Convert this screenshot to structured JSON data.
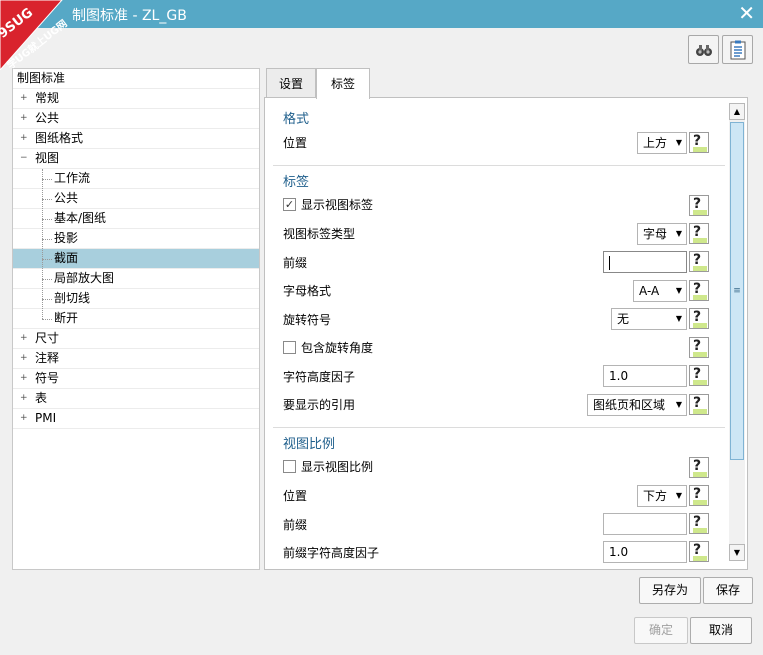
{
  "window": {
    "title": "制图标准 - ZL_GB",
    "close_glyph": "✕"
  },
  "watermark": {
    "line1": "9SUG",
    "line2": "学UG就上UG网"
  },
  "toolbar": [
    {
      "icon": "binoculars-icon"
    },
    {
      "icon": "clipboard-list-icon"
    }
  ],
  "tree": {
    "root": "制图标准",
    "items": [
      {
        "label": "常规",
        "level": 1,
        "expander": "+"
      },
      {
        "label": "公共",
        "level": 1,
        "expander": "+"
      },
      {
        "label": "图纸格式",
        "level": 1,
        "expander": "+"
      },
      {
        "label": "视图",
        "level": 1,
        "expander": "−"
      },
      {
        "label": "工作流",
        "level": 2
      },
      {
        "label": "公共",
        "level": 2
      },
      {
        "label": "基本/图纸",
        "level": 2
      },
      {
        "label": "投影",
        "level": 2
      },
      {
        "label": "截面",
        "level": 2,
        "selected": true
      },
      {
        "label": "局部放大图",
        "level": 2
      },
      {
        "label": "剖切线",
        "level": 2
      },
      {
        "label": "断开",
        "level": 2
      },
      {
        "label": "尺寸",
        "level": 1,
        "expander": "+"
      },
      {
        "label": "注释",
        "level": 1,
        "expander": "+"
      },
      {
        "label": "符号",
        "level": 1,
        "expander": "+"
      },
      {
        "label": "表",
        "level": 1,
        "expander": "+"
      },
      {
        "label": "PMI",
        "level": 1,
        "expander": "+"
      }
    ]
  },
  "tabs": [
    {
      "label": "设置",
      "active": false
    },
    {
      "label": "标签",
      "active": true
    }
  ],
  "sections": {
    "format": {
      "title": "格式",
      "position_label": "位置",
      "position_value": "上方"
    },
    "label": {
      "title": "标签",
      "show_view_label": "显示视图标签",
      "show_view_label_checked": true,
      "label_type_label": "视图标签类型",
      "label_type_value": "字母",
      "prefix_label": "前缀",
      "prefix_value": "",
      "letter_format_label": "字母格式",
      "letter_format_value": "A-A",
      "rotation_symbol_label": "旋转符号",
      "rotation_symbol_value": "无",
      "include_rotation_angle": "包含旋转角度",
      "include_rotation_angle_checked": false,
      "char_height_label": "字符高度因子",
      "char_height_value": "1.0",
      "reference_label": "要显示的引用",
      "reference_value": "图纸页和区域"
    },
    "scale": {
      "title": "视图比例",
      "show_scale": "显示视图比例",
      "show_scale_checked": false,
      "position_label": "位置",
      "position_value": "下方",
      "prefix_label": "前缀",
      "prefix_value": "",
      "prefix_height_label": "前缀字符高度因子",
      "prefix_height_value": "1.0"
    }
  },
  "help_glyph": "?",
  "check_glyph": "✓",
  "scrollbar": {
    "up": "▲",
    "down": "▼",
    "grip": "≡"
  },
  "buttons": {
    "save_as": "另存为",
    "save": "保存",
    "ok": "确定",
    "cancel": "取消"
  }
}
